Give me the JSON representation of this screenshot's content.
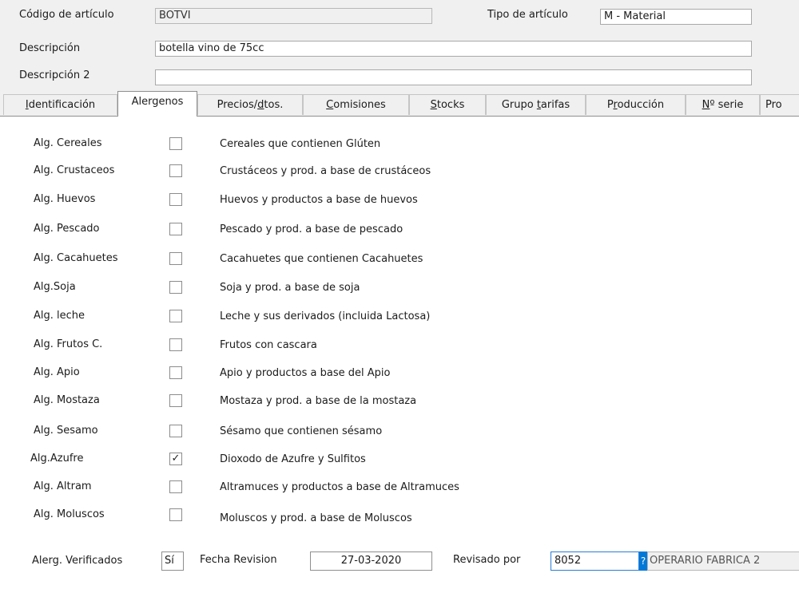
{
  "header": {
    "codigo_label": "Código de artículo",
    "codigo_value": "BOTVI",
    "tipo_label": "Tipo de artículo",
    "tipo_value": "M  - Material",
    "descripcion_label": "Descripción",
    "descripcion_value": "botella vino de 75cc",
    "descripcion2_label": "Descripción 2",
    "descripcion2_value": ""
  },
  "tabs": [
    {
      "pre": "",
      "u": "I",
      "post": "dentificación"
    },
    {
      "pre": "Alergenos",
      "u": "",
      "post": ""
    },
    {
      "pre": "Precios/",
      "u": "d",
      "post": "tos."
    },
    {
      "pre": "",
      "u": "C",
      "post": "omisiones"
    },
    {
      "pre": "",
      "u": "S",
      "post": "tocks"
    },
    {
      "pre": "Grupo ",
      "u": "t",
      "post": "arifas"
    },
    {
      "pre": "P",
      "u": "r",
      "post": "oducción"
    },
    {
      "pre": "",
      "u": "N",
      "post": "º serie"
    },
    {
      "pre": "Pro",
      "u": "",
      "post": ""
    }
  ],
  "allergens": [
    {
      "name": "Alg. Cereales",
      "mark": "",
      "desc": "Cereales que contienen Glúten"
    },
    {
      "name": "Alg. Crustaceos",
      "mark": "",
      "desc": "Crustáceos y prod. a base de crustáceos"
    },
    {
      "name": "Alg. Huevos",
      "mark": "",
      "desc": "Huevos y productos a base de huevos"
    },
    {
      "name": "Alg. Pescado",
      "mark": "",
      "desc": "Pescado y prod. a base de pescado"
    },
    {
      "name": "Alg. Cacahuetes",
      "mark": "",
      "desc": "Cacahuetes que contienen Cacahuetes"
    },
    {
      "name": "Alg.Soja",
      "mark": "",
      "desc": "Soja y prod. a base de soja"
    },
    {
      "name": "Alg. leche",
      "mark": "",
      "desc": "Leche y sus derivados (incluida Lactosa)"
    },
    {
      "name": "Alg. Frutos C.",
      "mark": "",
      "desc": "Frutos con cascara"
    },
    {
      "name": "Alg. Apio",
      "mark": "",
      "desc": "Apio y productos a base del Apio"
    },
    {
      "name": "Alg. Mostaza",
      "mark": "",
      "desc": "Mostaza y prod. a base de la mostaza"
    },
    {
      "name": "Alg. Sesamo",
      "mark": "",
      "desc": "Sésamo que contienen sésamo"
    },
    {
      "name": "Alg.Azufre",
      "mark": "✓",
      "desc": "Dioxodo de Azufre y Sulfitos"
    },
    {
      "name": "Alg. Altram",
      "mark": "",
      "desc": "Altramuces y productos a base de Altramuces"
    },
    {
      "name": "Alg. Moluscos",
      "mark": "",
      "desc": "Moluscos y prod. a base de Moluscos"
    }
  ],
  "footer": {
    "verificados_label": "Alerg. Verificados",
    "verificados_value": "Sí",
    "fecha_label": "Fecha Revision",
    "fecha_value": "27-03-2020",
    "revisado_label": "Revisado por",
    "revisado_code": "8052",
    "lookup_glyph": "?",
    "revisado_name": "OPERARIO FABRICA 2"
  },
  "colors": {
    "selection": "#0078d7",
    "panel": "#ffffff",
    "window": "#f0f0f0"
  }
}
